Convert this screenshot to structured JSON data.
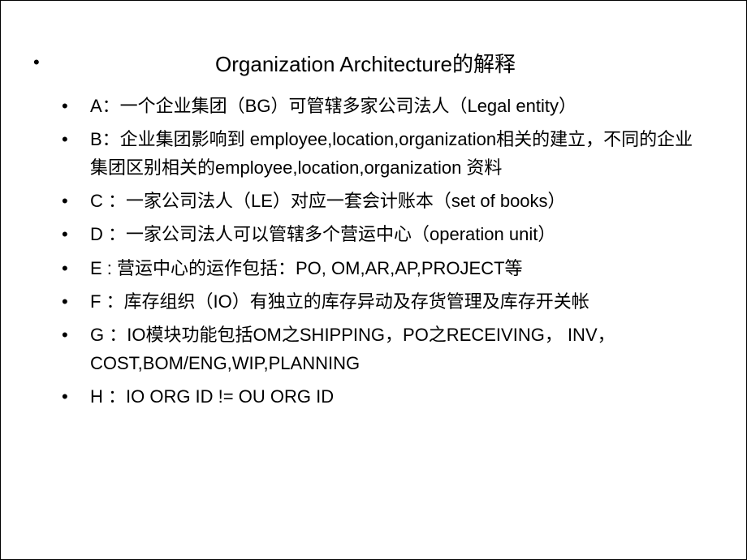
{
  "slide": {
    "title": "Organization Architecture的解释",
    "items": [
      "A：一个企业集团（BG）可管辖多家公司法人（Legal entity）",
      "B：企业集团影响到 employee,location,organization相关的建立，不同的企业集团区别相关的employee,location,organization 资料",
      "C ：一家公司法人（LE）对应一套会计账本（set of books）",
      "D ：一家公司法人可以管辖多个营运中心（operation unit）",
      "E : 营运中心的运作包括：PO, OM,AR,AP,PROJECT等",
      "F ：库存组织（IO）有独立的库存异动及存货管理及库存开关帐",
      "G ：IO模块功能包括OM之SHIPPING，PO之RECEIVING， INV，COST,BOM/ENG,WIP,PLANNING",
      "H ：IO ORG ID !=  OU ORG ID"
    ]
  }
}
